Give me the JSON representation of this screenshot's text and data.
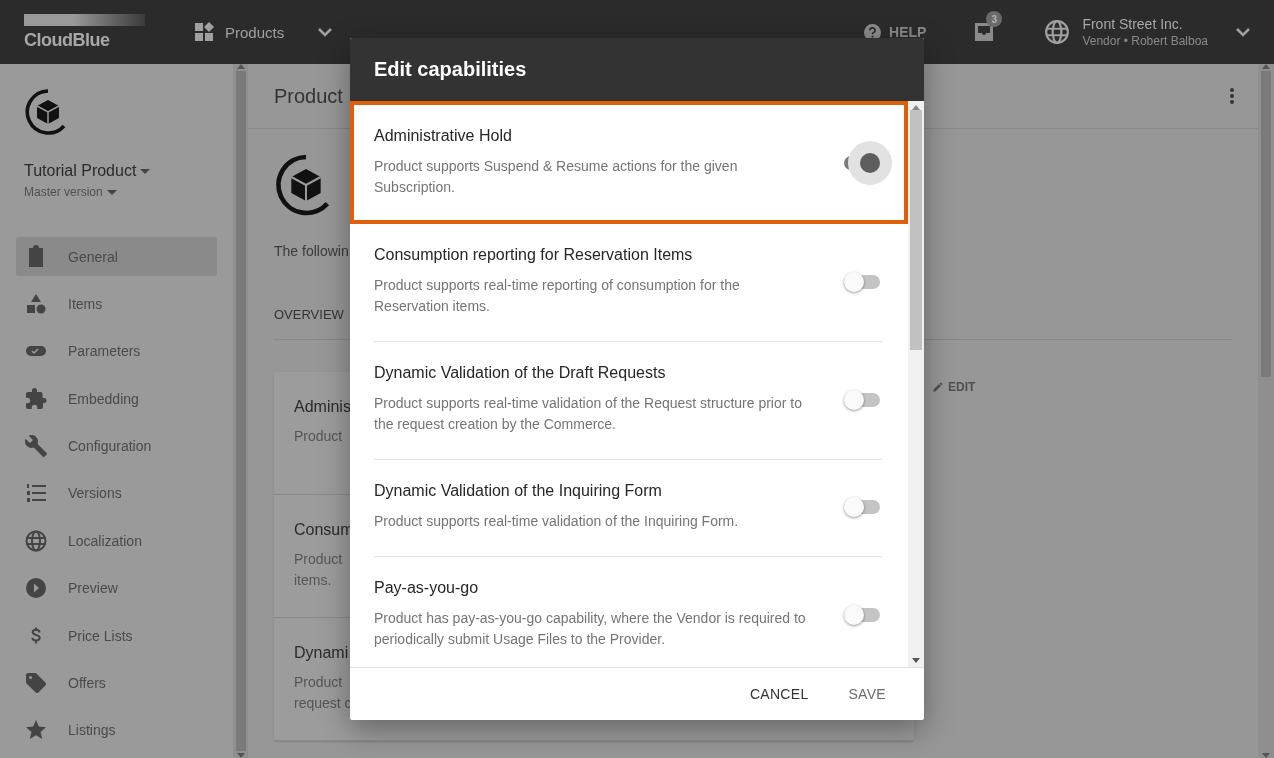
{
  "header": {
    "logo": "CloudBlue",
    "module": "Products",
    "help": "HELP",
    "notification_count": "3",
    "account": {
      "name": "Front Street Inc.",
      "subtitle": "Vendor • Robert Balboa"
    }
  },
  "sidebar": {
    "product": "Tutorial Product",
    "version": "Master version",
    "items": [
      {
        "label": "General",
        "selected": true
      },
      {
        "label": "Items",
        "selected": false
      },
      {
        "label": "Parameters",
        "selected": false
      },
      {
        "label": "Embedding",
        "selected": false
      },
      {
        "label": "Configuration",
        "selected": false
      },
      {
        "label": "Versions",
        "selected": false
      },
      {
        "label": "Localization",
        "selected": false
      },
      {
        "label": "Preview",
        "selected": false
      },
      {
        "label": "Price Lists",
        "selected": false
      },
      {
        "label": "Offers",
        "selected": false
      },
      {
        "label": "Listings",
        "selected": false
      }
    ]
  },
  "main": {
    "title": "Product",
    "intro": "The followin",
    "tab": "OVERVIEW",
    "edit": "EDIT",
    "cards": [
      {
        "title": "Adminis",
        "lines": [
          "Product"
        ]
      },
      {
        "title": "Consum",
        "lines": [
          "Product",
          "items."
        ]
      },
      {
        "title": "Dynami",
        "lines": [
          "Product",
          "request c"
        ]
      }
    ]
  },
  "dialog": {
    "title": "Edit capabilities",
    "capabilities": [
      {
        "title": "Administrative Hold",
        "description": "Product supports Suspend & Resume actions for the given Subscription.",
        "on": true,
        "highlighted": true
      },
      {
        "title": "Consumption reporting for Reservation Items",
        "description": "Product supports real-time reporting of consumption for the Reservation items.",
        "on": false,
        "highlighted": false
      },
      {
        "title": "Dynamic Validation of the Draft Requests",
        "description": "Product supports real-time validation of the Request structure prior to the request creation by the Commerce.",
        "on": false,
        "highlighted": false
      },
      {
        "title": "Dynamic Validation of the Inquiring Form",
        "description": "Product supports real-time validation of the Inquiring Form.",
        "on": false,
        "highlighted": false
      },
      {
        "title": "Pay-as-you-go",
        "description": "Product has pay-as-you-go capability, where the Vendor is required to periodically submit Usage Files to the Provider.",
        "on": false,
        "highlighted": false
      }
    ],
    "buttons": [
      "CANCEL",
      "SAVE"
    ]
  }
}
